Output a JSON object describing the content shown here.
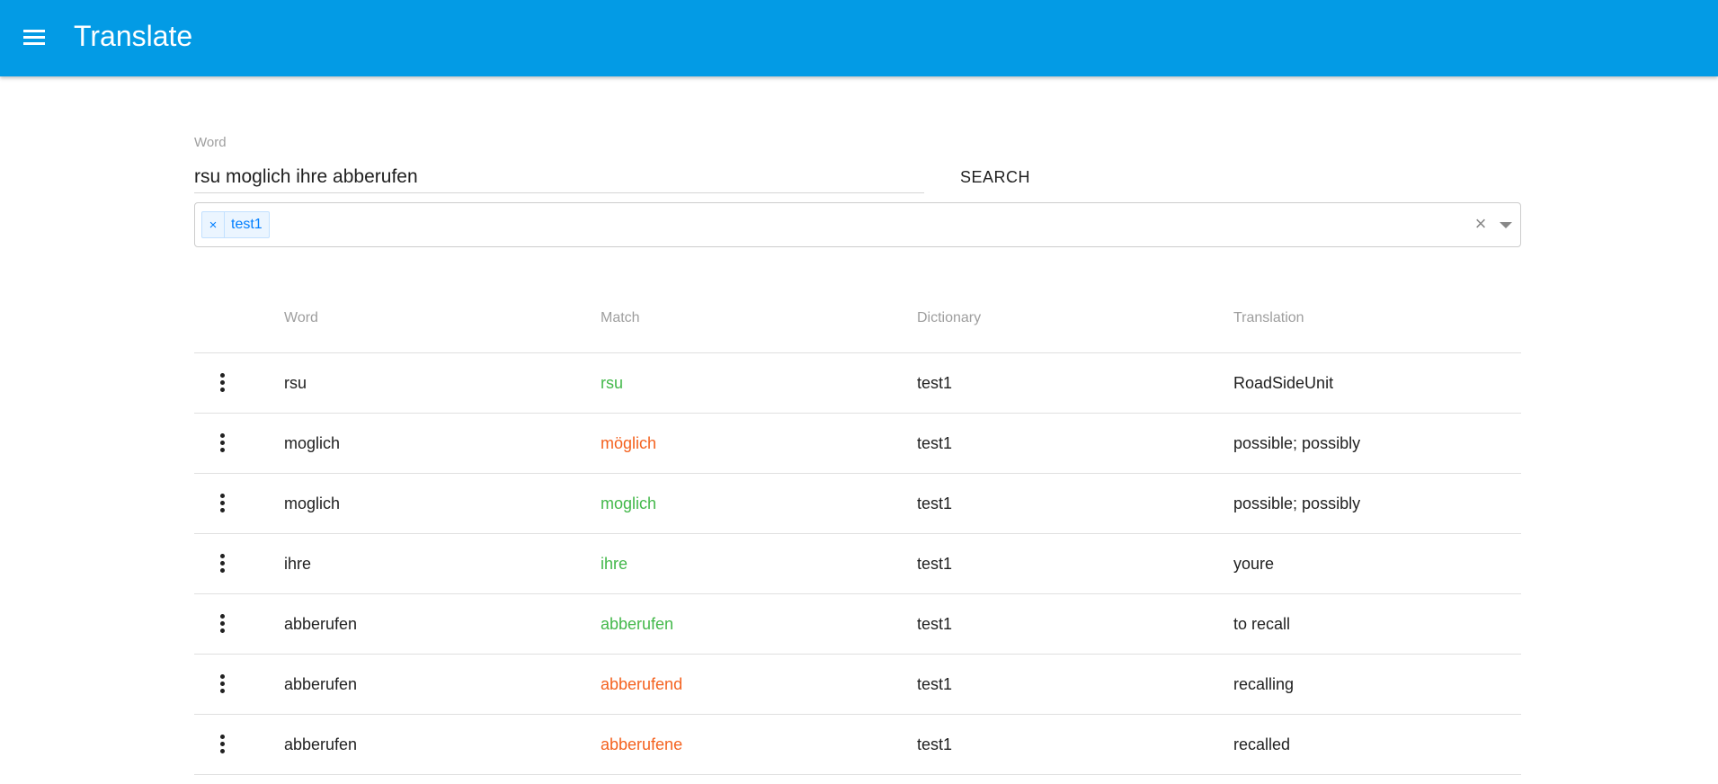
{
  "appbar": {
    "title": "Translate",
    "color": "#039be5"
  },
  "form": {
    "word_label": "Word",
    "word_value": "rsu moglich ihre abberufen",
    "search_label": "SEARCH",
    "selected_dictionaries": [
      {
        "remove_symbol": "×",
        "label": "test1"
      }
    ],
    "clear_symbol": "×"
  },
  "table": {
    "headers": {
      "word": "Word",
      "match": "Match",
      "dictionary": "Dictionary",
      "translation": "Translation"
    },
    "match_colors": {
      "exact": "#43b84a",
      "fuzzy": "#f4611e"
    },
    "rows": [
      {
        "word": "rsu",
        "match": "rsu",
        "match_type": "exact",
        "dictionary": "test1",
        "translation": "RoadSideUnit"
      },
      {
        "word": "moglich",
        "match": "möglich",
        "match_type": "fuzzy",
        "dictionary": "test1",
        "translation": "possible; possibly"
      },
      {
        "word": "moglich",
        "match": "moglich",
        "match_type": "exact",
        "dictionary": "test1",
        "translation": "possible; possibly"
      },
      {
        "word": "ihre",
        "match": "ihre",
        "match_type": "exact",
        "dictionary": "test1",
        "translation": "youre"
      },
      {
        "word": "abberufen",
        "match": "abberufen",
        "match_type": "exact",
        "dictionary": "test1",
        "translation": "to recall"
      },
      {
        "word": "abberufen",
        "match": "abberufend",
        "match_type": "fuzzy",
        "dictionary": "test1",
        "translation": "recalling"
      },
      {
        "word": "abberufen",
        "match": "abberufene",
        "match_type": "fuzzy",
        "dictionary": "test1",
        "translation": "recalled"
      }
    ]
  }
}
